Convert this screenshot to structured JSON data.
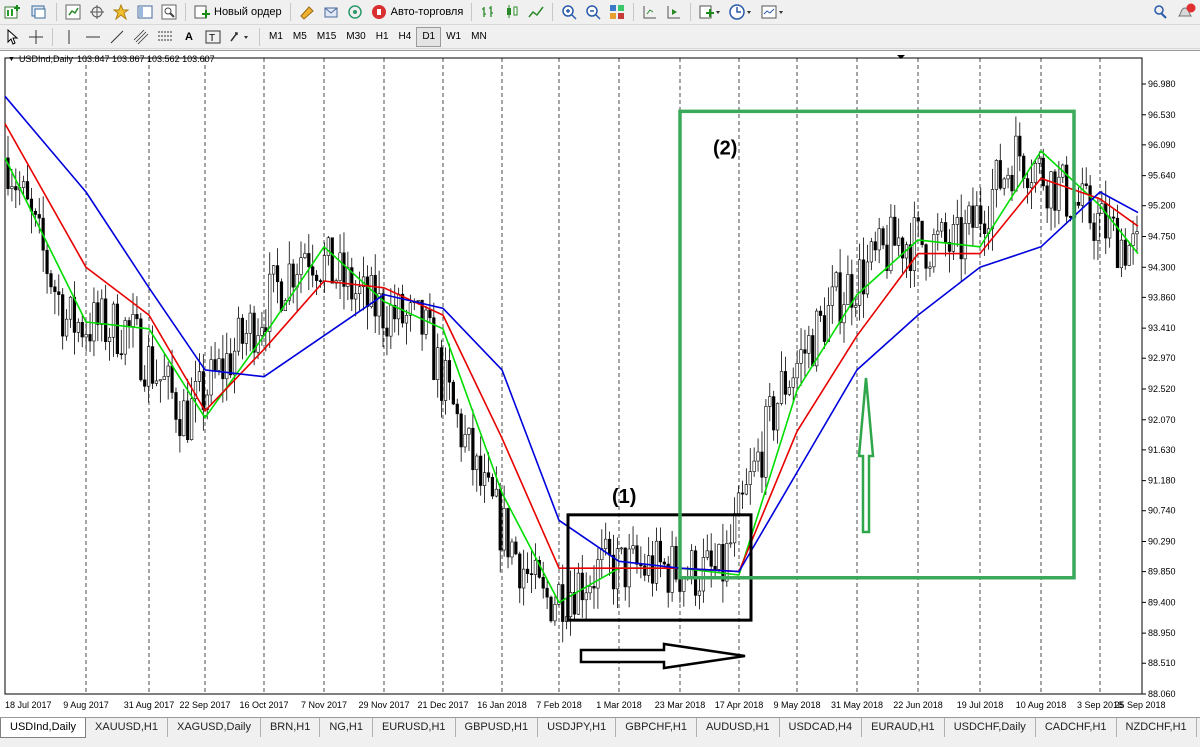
{
  "toolbar": {
    "new_order_label": "Новый ордер",
    "autotrading_label": "Авто-торговля",
    "timeframes": [
      "M1",
      "M5",
      "M15",
      "M30",
      "H1",
      "H4",
      "D1",
      "W1",
      "MN"
    ],
    "active_timeframe": "D1"
  },
  "chart_header": {
    "symbol": "USDInd,Daily",
    "ohlc": "103.847 103.867 103.562 103.607"
  },
  "annotations": {
    "label_1": "(1)",
    "label_2": "(2)"
  },
  "colors": {
    "ma_fast": "#00dd00",
    "ma_mid": "#e80000",
    "ma_slow": "#0000dd",
    "box_2": "#3aaa5a",
    "arrow_up": "#2fa64a",
    "arrow_right": "#000000"
  },
  "chart_data": {
    "type": "line",
    "title": "USDInd,Daily",
    "y_ticks": [
      "96.980",
      "96.530",
      "96.090",
      "95.640",
      "95.200",
      "94.750",
      "94.300",
      "93.860",
      "93.410",
      "92.970",
      "92.520",
      "92.070",
      "91.630",
      "91.180",
      "90.740",
      "90.290",
      "89.850",
      "89.400",
      "88.950",
      "88.510",
      "88.060"
    ],
    "x_ticks": [
      "18 Jul 2017",
      "9 Aug 2017",
      "31 Aug 2017",
      "22 Sep 2017",
      "16 Oct 2017",
      "7 Nov 2017",
      "29 Nov 2017",
      "21 Dec 2017",
      "16 Jan 2018",
      "7 Feb 2018",
      "1 Mar 2018",
      "23 Mar 2018",
      "17 Apr 2018",
      "9 May 2018",
      "31 May 2018",
      "22 Jun 2018",
      "19 Jul 2018",
      "10 Aug 2018",
      "3 Sep 2018",
      "25 Sep 2018"
    ],
    "ylim": [
      88.06,
      96.98
    ],
    "grid": true,
    "series": [
      {
        "color": "#00dd00",
        "x": [
          "18 Jul 2017",
          "9 Aug 2017",
          "31 Aug 2017",
          "22 Sep 2017",
          "16 Oct 2017",
          "7 Nov 2017",
          "29 Nov 2017",
          "21 Dec 2017",
          "16 Jan 2018",
          "7 Feb 2018",
          "1 Mar 2018",
          "23 Mar 2018",
          "17 Apr 2018",
          "9 May 2018",
          "31 May 2018",
          "22 Jun 2018",
          "19 Jul 2018",
          "10 Aug 2018",
          "3 Sep 2018",
          "25 Sep 2018"
        ],
        "values": [
          95.9,
          93.5,
          93.4,
          92.1,
          93.3,
          94.6,
          93.8,
          93.4,
          91.0,
          89.4,
          89.9,
          89.9,
          89.8,
          92.5,
          93.9,
          94.7,
          94.6,
          96.0,
          95.2,
          94.5
        ]
      },
      {
        "color": "#e80000",
        "x": [
          "18 Jul 2017",
          "9 Aug 2017",
          "31 Aug 2017",
          "22 Sep 2017",
          "16 Oct 2017",
          "7 Nov 2017",
          "29 Nov 2017",
          "21 Dec 2017",
          "16 Jan 2018",
          "7 Feb 2018",
          "1 Mar 2018",
          "23 Mar 2018",
          "17 Apr 2018",
          "9 May 2018",
          "31 May 2018",
          "22 Jun 2018",
          "19 Jul 2018",
          "10 Aug 2018",
          "3 Sep 2018",
          "25 Sep 2018"
        ],
        "values": [
          96.4,
          94.3,
          93.6,
          92.2,
          93.1,
          94.1,
          94.0,
          93.6,
          91.8,
          89.9,
          89.9,
          89.9,
          89.85,
          91.9,
          93.3,
          94.5,
          94.5,
          95.6,
          95.3,
          94.9
        ]
      },
      {
        "color": "#0000dd",
        "x": [
          "18 Jul 2017",
          "9 Aug 2017",
          "31 Aug 2017",
          "22 Sep 2017",
          "16 Oct 2017",
          "7 Nov 2017",
          "29 Nov 2017",
          "21 Dec 2017",
          "16 Jan 2018",
          "7 Feb 2018",
          "1 Mar 2018",
          "23 Mar 2018",
          "17 Apr 2018",
          "9 May 2018",
          "31 May 2018",
          "22 Jun 2018",
          "19 Jul 2018",
          "10 Aug 2018",
          "3 Sep 2018",
          "25 Sep 2018"
        ],
        "values": [
          96.8,
          95.4,
          94.0,
          92.8,
          92.7,
          93.3,
          93.9,
          93.7,
          92.8,
          90.6,
          90.0,
          89.9,
          89.85,
          91.3,
          92.8,
          93.6,
          94.3,
          94.6,
          95.4,
          95.1
        ]
      }
    ]
  },
  "tabs": [
    {
      "label": "USDInd,Daily",
      "active": true
    },
    {
      "label": "XAUUSD,H1"
    },
    {
      "label": "XAGUSD,Daily"
    },
    {
      "label": "BRN,H1"
    },
    {
      "label": "NG,H1"
    },
    {
      "label": "EURUSD,H1"
    },
    {
      "label": "GBPUSD,H1"
    },
    {
      "label": "USDJPY,H1"
    },
    {
      "label": "GBPCHF,H1"
    },
    {
      "label": "AUDUSD,H1"
    },
    {
      "label": "USDCAD,H4"
    },
    {
      "label": "EURAUD,H1"
    },
    {
      "label": "USDCHF,Daily"
    },
    {
      "label": "CADCHF,H1"
    },
    {
      "label": "NZDCHF,H1"
    }
  ]
}
